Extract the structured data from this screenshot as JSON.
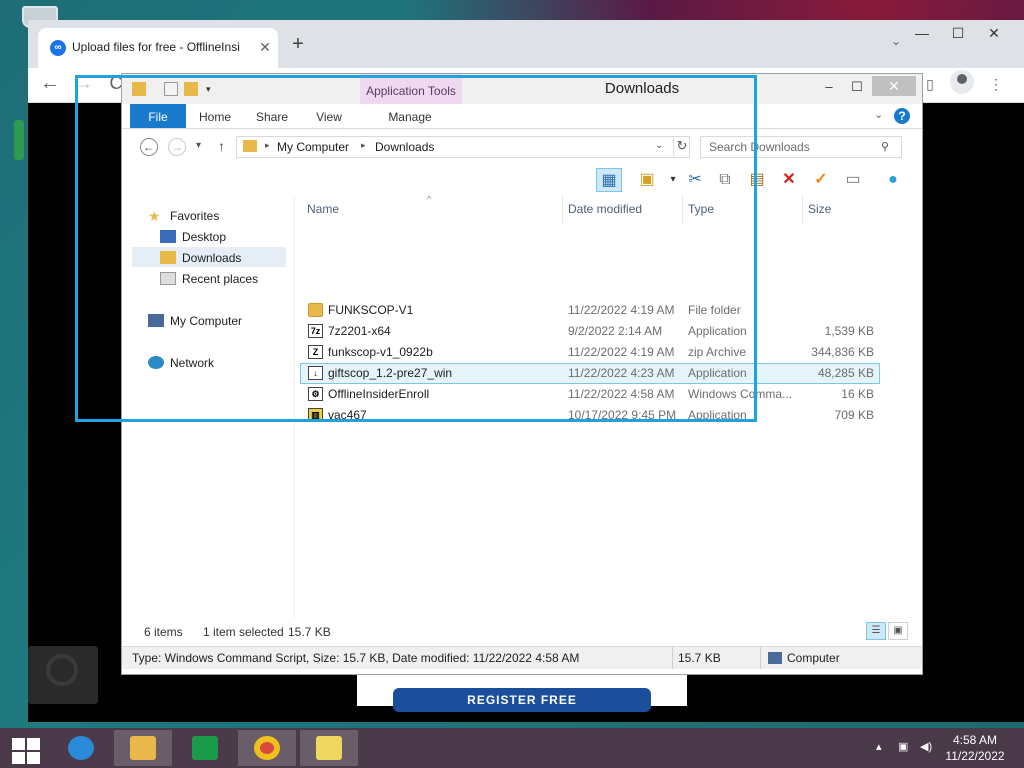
{
  "browser": {
    "tab_title": "Upload files for free - OfflineInsi",
    "new_tab": "+",
    "tab_close": "✕",
    "minimize": "—",
    "maximize": "☐",
    "close": "✕",
    "back": "←",
    "forward": "→",
    "reload": "C",
    "webpage_button": "REGISTER FREE"
  },
  "explorer": {
    "title": "Downloads",
    "context_tab": "Application Tools",
    "ribbon_tabs": [
      "File",
      "Home",
      "Share",
      "View",
      "Manage"
    ],
    "address": {
      "crumbs": [
        "My Computer",
        "Downloads"
      ]
    },
    "search_placeholder": "Search Downloads",
    "nav": {
      "favorites": "Favorites",
      "desktop": "Desktop",
      "downloads": "Downloads",
      "recent": "Recent places",
      "computer": "My Computer",
      "network": "Network"
    },
    "columns": {
      "name": "Name",
      "date": "Date modified",
      "type": "Type",
      "size": "Size"
    },
    "files": [
      {
        "name": "FUNKSCOP-V1",
        "date": "11/22/2022 4:19 AM",
        "type": "File folder",
        "size": "",
        "icon": "folder-icon"
      },
      {
        "name": "7z2201-x64",
        "date": "9/2/2022 2:14 AM",
        "type": "Application",
        "size": "1,539 KB",
        "icon": "7zip-icon"
      },
      {
        "name": "funkscop-v1_0922b",
        "date": "11/22/2022 4:19 AM",
        "type": "zip Archive",
        "size": "344,836 KB",
        "icon": "zip-icon"
      },
      {
        "name": "giftscop_1.2-pre27_win",
        "date": "11/22/2022 4:23 AM",
        "type": "Application",
        "size": "48,285 KB",
        "icon": "installer-icon"
      },
      {
        "name": "OfflineInsiderEnroll",
        "date": "11/22/2022 4:58 AM",
        "type": "Windows Comma...",
        "size": "16 KB",
        "icon": "script-icon"
      },
      {
        "name": "vac467",
        "date": "10/17/2022 9:45 PM",
        "type": "Application",
        "size": "709 KB",
        "icon": "app-icon"
      }
    ],
    "status": {
      "items": "6 items",
      "selected": "1 item selected",
      "selected_size": "15.7 KB"
    },
    "details": {
      "text": "Type: Windows Command Script, Size: 15.7 KB, Date modified: 11/22/2022 4:58 AM",
      "size": "15.7 KB",
      "location": "Computer"
    }
  },
  "taskbar": {
    "time": "4:58 AM",
    "date": "11/22/2022"
  },
  "colors": {
    "selection_box": "#1ea3dc",
    "ribbon_file": "#1979ca",
    "taskbar": "#4a3a4a"
  }
}
